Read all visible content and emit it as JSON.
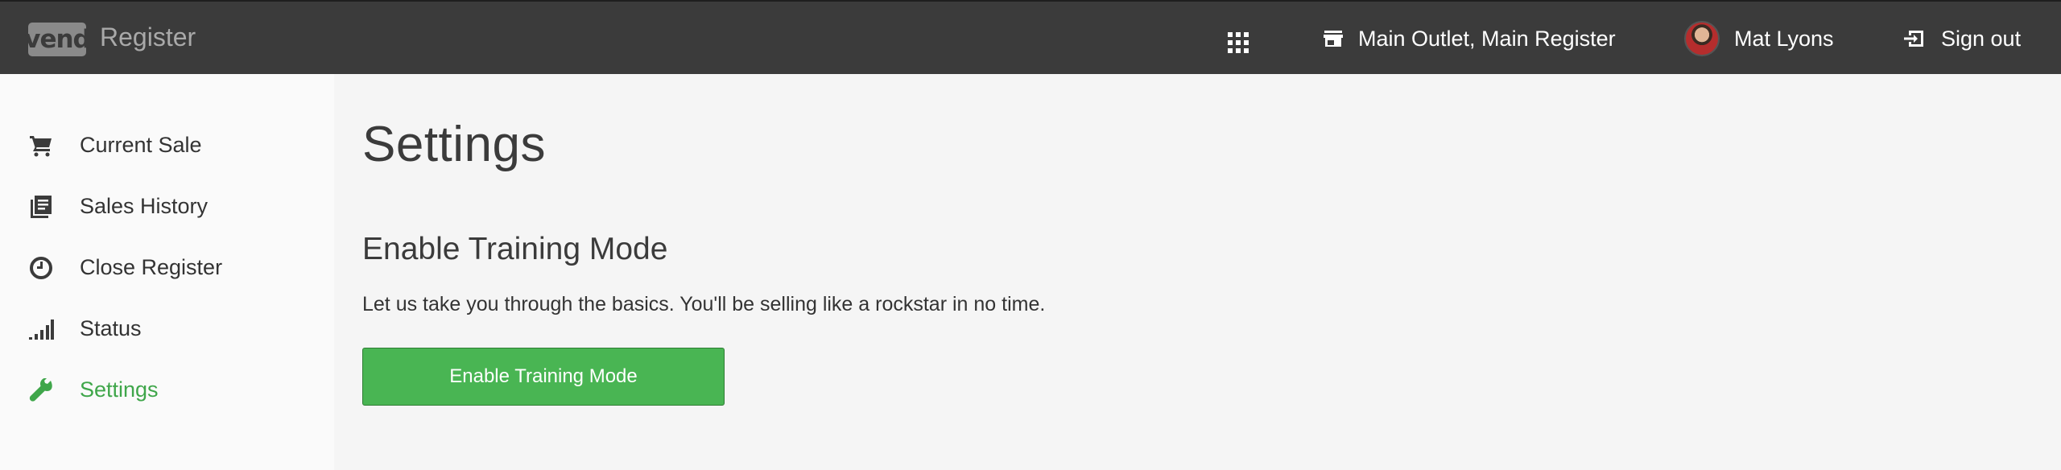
{
  "header": {
    "logo_text": "vend",
    "app_title": "Register",
    "apps_icon": "grid-icon",
    "outlet_label": "Main Outlet, Main Register",
    "user_name": "Mat Lyons",
    "signout_label": "Sign out"
  },
  "sidebar": {
    "items": [
      {
        "label": "Current Sale",
        "icon": "cart-icon",
        "active": false
      },
      {
        "label": "Sales History",
        "icon": "history-icon",
        "active": false
      },
      {
        "label": "Close Register",
        "icon": "clock-icon",
        "active": false
      },
      {
        "label": "Status",
        "icon": "signal-icon",
        "active": false
      },
      {
        "label": "Settings",
        "icon": "wrench-icon",
        "active": true
      }
    ]
  },
  "main": {
    "page_title": "Settings",
    "section_title": "Enable Training Mode",
    "section_description": "Let us take you through the basics. You'll be selling like a rockstar in no time.",
    "button_label": "Enable Training Mode"
  },
  "colors": {
    "topbar": "#3b3b3b",
    "accent_green": "#49b553",
    "active_text": "#3fa64a"
  }
}
